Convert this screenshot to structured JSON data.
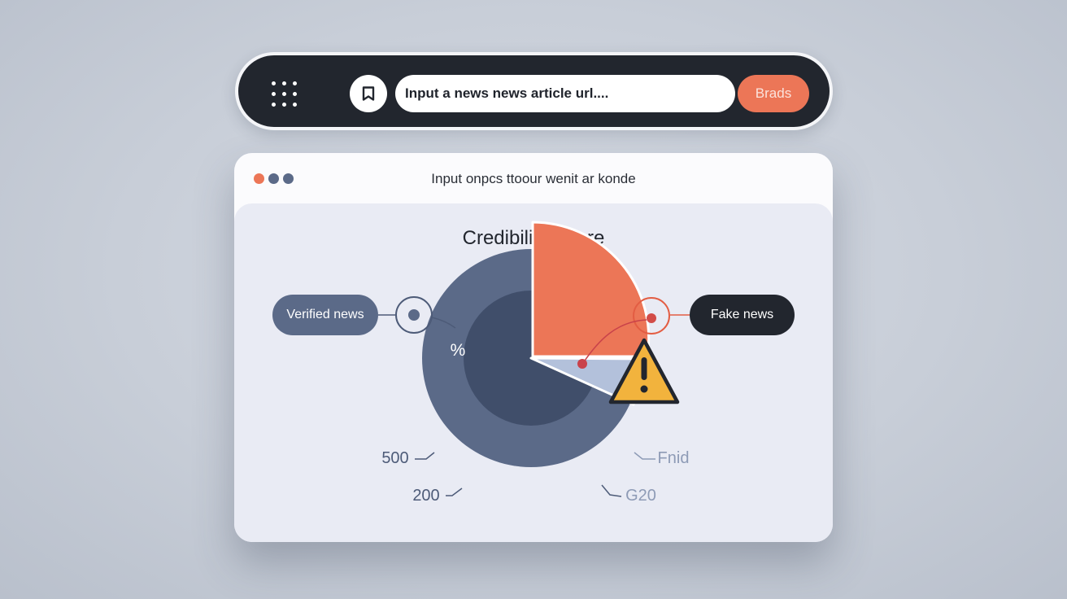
{
  "search": {
    "placeholder": "Input a news news article url....",
    "button_label": "Brads"
  },
  "card": {
    "window_title": "Input onpcs ttoour wenit ar konde",
    "score_title": "Credibility Score",
    "pill_verified": "Verified news",
    "pill_fake": "Fake news",
    "percent_symbol": "%",
    "chart_labels": {
      "bottom_left_1": "500",
      "bottom_left_2": "200",
      "bottom_right_1": "Fnid",
      "bottom_right_2": "G20"
    }
  },
  "colors": {
    "dark": "#22262e",
    "accent": "#ec7657",
    "slate": "#5b6a88",
    "slate_dark": "#404e6a",
    "light_slice": "#b3c1db",
    "warning": "#f2b33d"
  },
  "icons": [
    "grid-menu-icon",
    "bookmark-icon",
    "warning-icon"
  ]
}
